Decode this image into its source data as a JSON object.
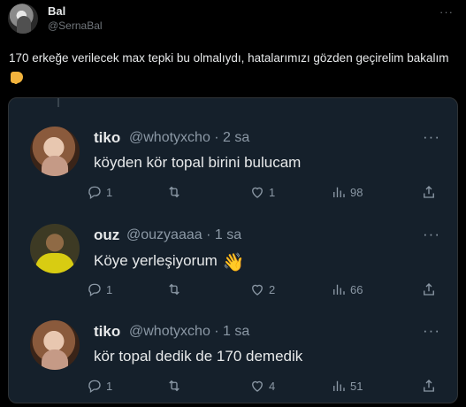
{
  "post": {
    "author_name": "Bal",
    "author_handle": "@SernaBal",
    "more": "···",
    "text": "170 erkeğe verilecek max tepki bu olmalıydı, hatalarımızı gözden geçirelim bakalım"
  },
  "icons": {
    "reply": "reply-icon",
    "retweet": "retweet-icon",
    "like": "heart-icon",
    "views": "views-icon",
    "share": "share-icon"
  },
  "replies": [
    {
      "name": "tiko",
      "meta": "@whotyxcho · 2 sa",
      "text": "köyden kör topal birini bulucam",
      "replies": "1",
      "retweets": "",
      "likes": "1",
      "views": "98"
    },
    {
      "name": "ouz",
      "meta": "@ouzyaaaa · 1 sa",
      "text": "Köye yerleşiyorum",
      "emoji": "👋",
      "replies": "1",
      "retweets": "",
      "likes": "2",
      "views": "66"
    },
    {
      "name": "tiko",
      "meta": "@whotyxcho · 1 sa",
      "text": "kör topal dedik de 170 demedik",
      "replies": "1",
      "retweets": "",
      "likes": "4",
      "views": "51"
    }
  ],
  "more": "···"
}
